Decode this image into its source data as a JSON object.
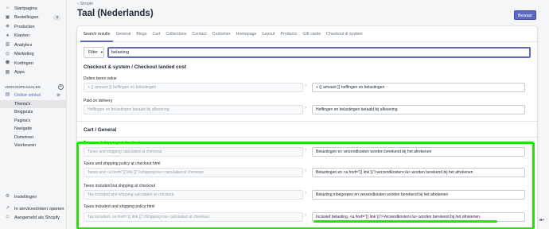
{
  "sidebar": {
    "items": [
      {
        "label": "Startpagina",
        "icon": "home-icon",
        "glyph": "⌂"
      },
      {
        "label": "Bestellingen",
        "icon": "orders-icon",
        "glyph": "▣",
        "badge": "3"
      },
      {
        "label": "Producten",
        "icon": "products-icon",
        "glyph": "◈"
      },
      {
        "label": "Klanten",
        "icon": "customers-icon",
        "glyph": "●"
      },
      {
        "label": "Analytics",
        "icon": "analytics-icon",
        "glyph": "▥"
      },
      {
        "label": "Marketing",
        "icon": "marketing-icon",
        "glyph": "◎"
      },
      {
        "label": "Kortingen",
        "icon": "discounts-icon",
        "glyph": "⬢"
      },
      {
        "label": "Apps",
        "icon": "apps-icon",
        "glyph": "▦"
      }
    ],
    "sales_channels_label": "VERKOOPKANALEN",
    "online_store": "Online winkel",
    "sub_items": [
      "Thema's",
      "Blogposts",
      "Pagina's",
      "Navigatie",
      "Domeinen",
      "Voorkeuren"
    ],
    "active_sub": "Thema's",
    "bottom": [
      {
        "label": "Instellingen",
        "icon": "settings-icon",
        "glyph": "⚙"
      },
      {
        "label": "In services/intern openen",
        "icon": "open-icon",
        "glyph": "↗"
      },
      {
        "label": "Aangemeld als Shopify",
        "icon": "user-icon",
        "glyph": "☺"
      }
    ]
  },
  "header": {
    "back_label": "Simple",
    "title": "Taal (Nederlands)",
    "save_label": "Bewaar"
  },
  "tabs": [
    "Search results",
    "General",
    "Blogs",
    "Cart",
    "Collections",
    "Contact",
    "Customer",
    "Homepage",
    "Layout",
    "Products",
    "Gift cards",
    "Checkout & system"
  ],
  "active_tab": "Search results",
  "filter": {
    "label": "Filter",
    "search_value": "belasting"
  },
  "groups": {
    "checkout": {
      "title": "Checkout & system / Checkout landed cost",
      "rows": [
        {
          "label": "Duties taxes value",
          "source": "+ {{ amount }} heffingen en belastingen",
          "translation": "+ {{ amount }} heffingen en belastingen"
        },
        {
          "label": "Paid on delivery",
          "source": "Heffingen en belastingen betaald bij aflevering",
          "translation": "Heffingen en belastingen betaald bij aflevering"
        }
      ]
    },
    "cart": {
      "title": "Cart / General",
      "rows": [
        {
          "label": "Taxes and shipping at checkout",
          "source": "Taxes and shipping calculated at checkout",
          "translation": "Belastingen en verzendkosten worden berekend bij het afrekenen"
        },
        {
          "label": "Taxes and shipping policy at checkout html",
          "source": "Taxes and <a href=\"{{ link }}\">shipping</a> calculated at checkout",
          "translation": "Belastingen en <a href=\"{{ link }}\">verzendkosten</a> worden berekend bij het afrekenen"
        },
        {
          "label": "Taxes included but shipping at checkout",
          "source": "Tax included and shipping calculated at checkout",
          "translation": "Belasting inbegrepen en verzendkosten worden berekend bij het afrekenen"
        },
        {
          "label": "Taxes included and shipping policy html",
          "source": "Tax included. <a href=\"{{ link }}\">Shipping</a> calculated at checkout",
          "translation": "Inclusief belasting. <a href=\"{{ link }}\">Verzendkosten</a> worden berekend bij het afrekenen."
        }
      ]
    }
  },
  "colors": {
    "accent": "#5c6ac4",
    "highlight": "#33d917"
  }
}
